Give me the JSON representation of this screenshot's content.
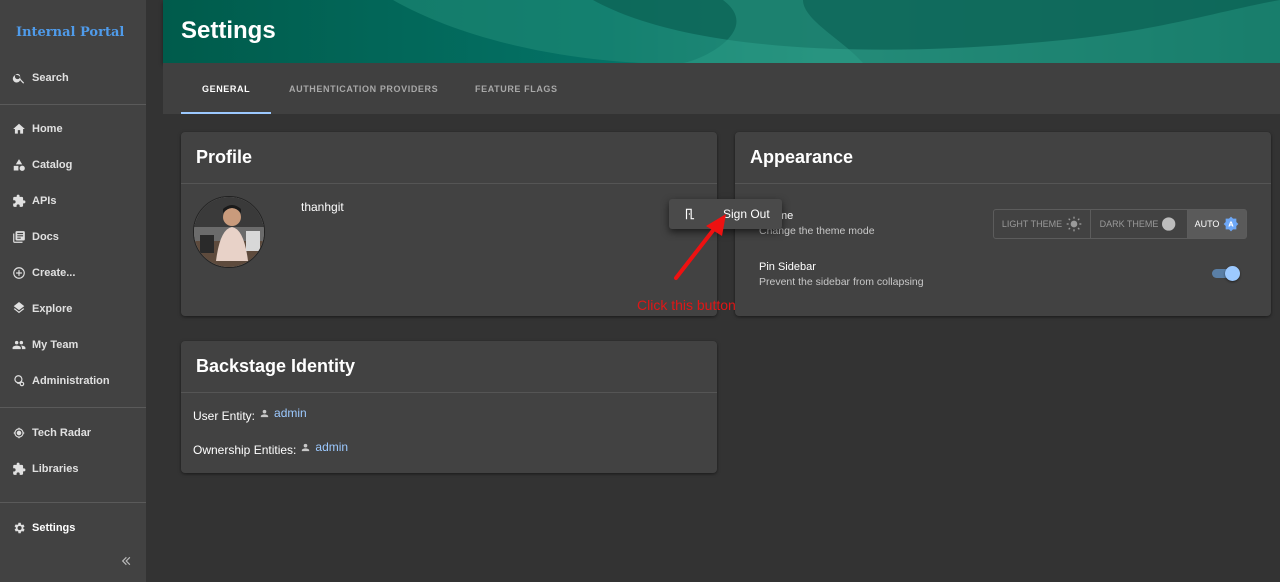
{
  "sidebar": {
    "app_title": "Internal Portal",
    "search_label": "Search",
    "items": [
      {
        "label": "Home",
        "icon": "home-icon"
      },
      {
        "label": "Catalog",
        "icon": "catalog-icon"
      },
      {
        "label": "APIs",
        "icon": "puzzle-icon"
      },
      {
        "label": "Docs",
        "icon": "docs-icon"
      },
      {
        "label": "Create...",
        "icon": "plus-circle-icon"
      },
      {
        "label": "Explore",
        "icon": "layers-icon"
      },
      {
        "label": "My Team",
        "icon": "team-icon"
      },
      {
        "label": "Administration",
        "icon": "admin-icon"
      }
    ],
    "secondary_items": [
      {
        "label": "Tech Radar",
        "icon": "radar-icon"
      },
      {
        "label": "Libraries",
        "icon": "puzzle-icon"
      }
    ],
    "settings_label": "Settings",
    "collapse_icon": "double-chevron-left-icon"
  },
  "header": {
    "title": "Settings"
  },
  "tabs": [
    {
      "label": "GENERAL",
      "active": true
    },
    {
      "label": "AUTHENTICATION PROVIDERS",
      "active": false
    },
    {
      "label": "FEATURE FLAGS",
      "active": false
    }
  ],
  "profile": {
    "title": "Profile",
    "username": "thanhgit"
  },
  "menu": {
    "sign_out_label": "Sign Out"
  },
  "appearance": {
    "title": "Appearance",
    "theme_label": "Theme",
    "theme_desc": "Change the theme mode",
    "theme_options": [
      {
        "label": "LIGHT THEME",
        "icon": "sun-icon",
        "selected": false
      },
      {
        "label": "DARK THEME",
        "icon": "moon-icon",
        "selected": false
      },
      {
        "label": "AUTO",
        "icon": "auto-brightness-icon",
        "selected": true
      }
    ],
    "pin_label": "Pin Sidebar",
    "pin_desc": "Prevent the sidebar from collapsing",
    "pin_enabled": true
  },
  "identity": {
    "title": "Backstage Identity",
    "user_entity_label": "User Entity:",
    "user_entity_value": "admin",
    "ownership_label": "Ownership Entities:",
    "ownership_value": "admin"
  },
  "annotation": {
    "text": "Click this button",
    "color": "#e01616"
  },
  "colors": {
    "accent": "#9cc9ff",
    "sidebar_bg": "#424242",
    "content_bg": "#333333",
    "header_teal": "#047266"
  }
}
